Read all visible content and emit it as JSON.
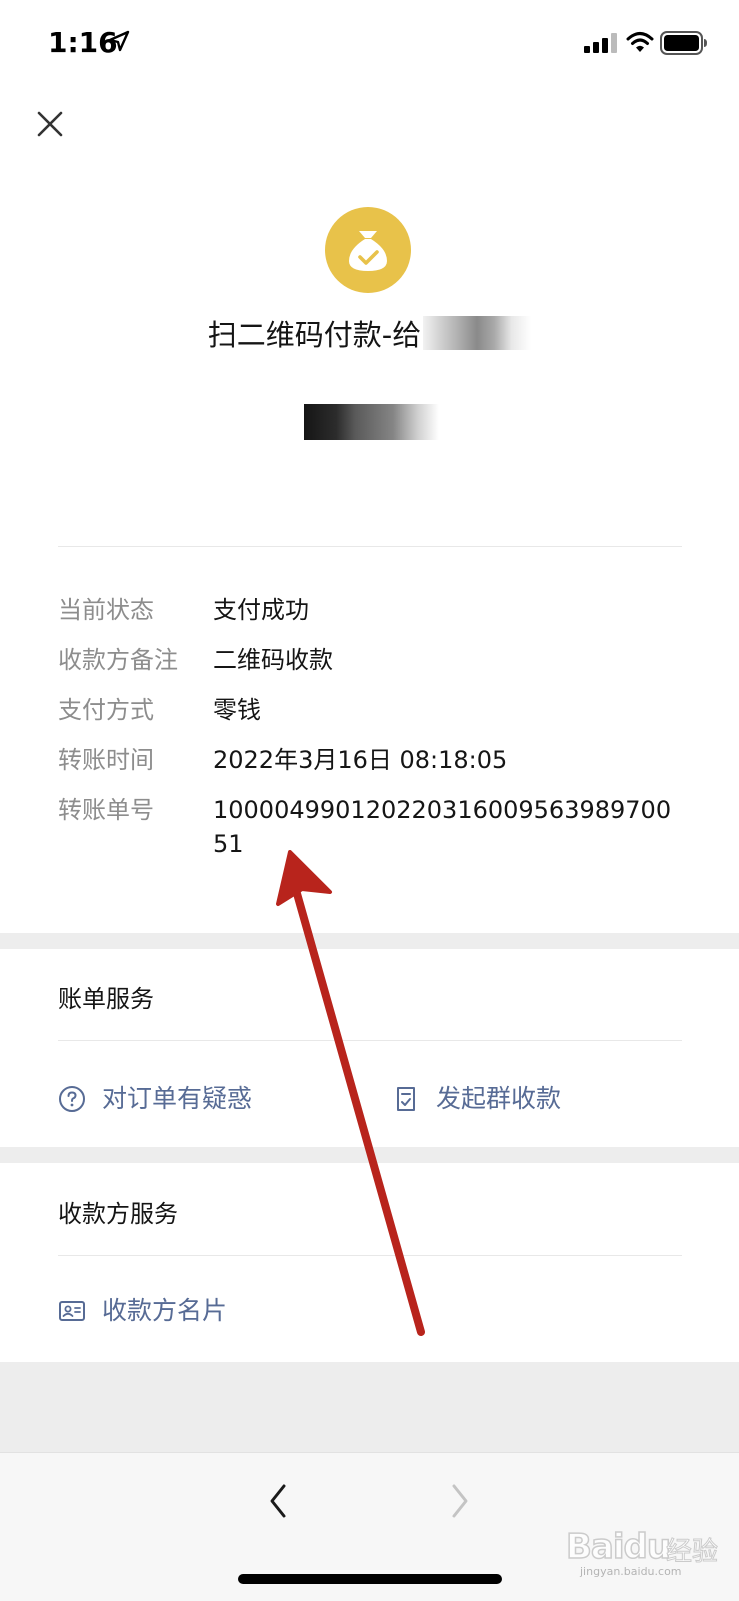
{
  "status_bar": {
    "time": "1:16"
  },
  "transaction": {
    "title": "扫二维码付款-给",
    "details": [
      {
        "label": "当前状态",
        "value": "支付成功"
      },
      {
        "label": "收款方备注",
        "value": "二维码收款"
      },
      {
        "label": "支付方式",
        "value": "零钱"
      },
      {
        "label": "转账时间",
        "value": "2022年3月16日 08:18:05"
      },
      {
        "label": "转账单号",
        "value": "100004990120220316009563989700 51"
      }
    ]
  },
  "bill_services": {
    "title": "账单服务",
    "question_label": "对订单有疑惑",
    "group_collect_label": "发起群收款"
  },
  "payee_services": {
    "title": "收款方服务",
    "card_label": "收款方名片"
  },
  "watermark": {
    "logo": "Baidu",
    "cn": "经验",
    "url": "jingyan.baidu.com"
  },
  "colors": {
    "accent_link": "#576b95",
    "payment_icon": "#e8c24a",
    "annotation_arrow": "#b8241c"
  },
  "icons": {
    "location": "location-arrow-icon",
    "payment": "money-bag-check-icon",
    "question": "question-circle-icon",
    "group_collect": "receipt-check-icon",
    "card": "id-card-icon",
    "back": "chevron-left-icon",
    "forward": "chevron-right-icon"
  }
}
